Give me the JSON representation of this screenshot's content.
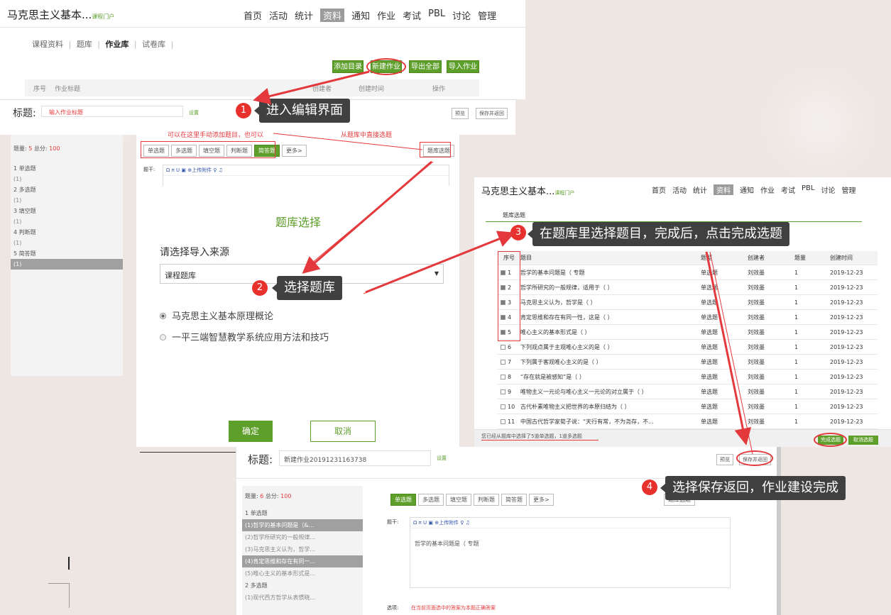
{
  "main_header": {
    "title": "马克思主义基本...",
    "portal": "课程门户",
    "nav": [
      "首页",
      "活动",
      "统计",
      "资料",
      "通知",
      "作业",
      "考试",
      "PBL",
      "讨论",
      "管理"
    ],
    "active_nav": "资料"
  },
  "subtabs": [
    "课程资料",
    "题库",
    "作业库",
    "试卷库"
  ],
  "active_subtab": "作业库",
  "toolbar": {
    "add_dir": "添加目录",
    "new_work": "新建作业",
    "export_all": "导出全部",
    "import_work": "导入作业"
  },
  "list_headers": {
    "no": "序号",
    "title": "作业标题",
    "creator": "创建者",
    "time": "创建时间",
    "op": "操作"
  },
  "editor1": {
    "title_label": "标题:",
    "title_placeholder": "输入作业标题",
    "setting": "设置",
    "preview": "预览",
    "save_return": "保存并返回",
    "count_label": "题量:",
    "count": "5",
    "score_label": "总分:",
    "score": "100",
    "stem_label": "题干:"
  },
  "outline1": [
    "1 单选题",
    "(1)",
    "2 多选题",
    "(1)",
    "3 填空题",
    "(1)",
    "4 判断题",
    "(1)",
    "5 简答题",
    "(1)"
  ],
  "type_buttons": [
    "单选题",
    "多选题",
    "填空题",
    "判断题",
    "简答题",
    "更多>"
  ],
  "bank_select_btn": "题库选题",
  "notes": {
    "manual": "可以在这里手动添加题目，也可以",
    "from_bank": "从题库中直接选题"
  },
  "editor_tools": "Ω π U ▣ ⊕上传附件 ♀ ♫",
  "dialog": {
    "title": "题库选择",
    "prompt": "请选择导入来源",
    "select": "课程题库",
    "options": [
      "马克思主义基本原理概论",
      "一平三端智慧教学系统应用方法和技巧"
    ],
    "ok": "确定",
    "cancel": "取消"
  },
  "callouts": [
    {
      "n": "1",
      "text": "进入编辑界面"
    },
    {
      "n": "2",
      "text": "选择题库"
    },
    {
      "n": "3",
      "text": "在题库里选择题目，完成后，点击完成选题"
    },
    {
      "n": "4",
      "text": "选择保存返回，作业建设完成"
    }
  ],
  "bank": {
    "tab": "题库选题",
    "headers": {
      "no": "序号",
      "q": "题目",
      "type": "题型",
      "creator": "创建者",
      "count": "题量",
      "time": "创建时间"
    },
    "rows": [
      {
        "n": "1",
        "q": "哲学的基本问题是（ 专题",
        "type": "单选题",
        "c": "刘效墨",
        "k": "1",
        "t": "2019-12-23",
        "checked": true
      },
      {
        "n": "2",
        "q": "哲学所研究的一般规律，适用于（ ）",
        "type": "单选题",
        "c": "刘效墨",
        "k": "1",
        "t": "2019-12-23",
        "checked": true
      },
      {
        "n": "3",
        "q": "马克思主义认为，哲学是（ ）",
        "type": "单选题",
        "c": "刘效墨",
        "k": "1",
        "t": "2019-12-23",
        "checked": true
      },
      {
        "n": "4",
        "q": "肯定思维和存在有同一性，这是（ ）",
        "type": "单选题",
        "c": "刘效墨",
        "k": "1",
        "t": "2019-12-23",
        "checked": true
      },
      {
        "n": "5",
        "q": "唯心主义的基本形式是（ ）",
        "type": "单选题",
        "c": "刘效墨",
        "k": "1",
        "t": "2019-12-23",
        "checked": true
      },
      {
        "n": "6",
        "q": "下列观点属于主观唯心主义的是（ ）",
        "type": "单选题",
        "c": "刘效墨",
        "k": "1",
        "t": "2019-12-23",
        "checked": false
      },
      {
        "n": "7",
        "q": "下列属于客观唯心主义的是（ ）",
        "type": "单选题",
        "c": "刘效墨",
        "k": "1",
        "t": "2019-12-23",
        "checked": false
      },
      {
        "n": "8",
        "q": "“存在就是被感知”是（ ）",
        "type": "单选题",
        "c": "刘效墨",
        "k": "1",
        "t": "2019-12-23",
        "checked": false
      },
      {
        "n": "9",
        "q": "唯物主义一元论与唯心主义一元论的对立属于（ ）",
        "type": "单选题",
        "c": "刘效墨",
        "k": "1",
        "t": "2019-12-23",
        "checked": false
      },
      {
        "n": "10",
        "q": "古代朴素唯物主义把世界的本原归结为（ ）",
        "type": "单选题",
        "c": "刘效墨",
        "k": "1",
        "t": "2019-12-23",
        "checked": false
      },
      {
        "n": "11",
        "q": "中国古代哲学家荀子说：“天行有常，不为尧存，不...",
        "type": "单选题",
        "c": "刘效墨",
        "k": "1",
        "t": "2019-12-23",
        "checked": false
      }
    ],
    "status": "您已经从题库中选择了5道单选题，1道多选题",
    "finish": "完成选题",
    "cancel": "取消选题"
  },
  "editor2": {
    "title_label": "标题:",
    "title_value": "新建作业20191231163738",
    "setting": "设置",
    "preview": "预览",
    "save_return": "保存并返回",
    "count_label": "题量:",
    "count": "6",
    "score_label": "总分:",
    "score": "100",
    "stem_label": "题干:",
    "stem_text": "哲学的基本问题是（ 专题",
    "options_label": "选项:",
    "options_hint": "在当前页面选中的答案为本题正确答案"
  },
  "outline2": [
    "1 单选题",
    "(1)哲学的基本问题是（&...",
    "(2)哲学所研究的一般规律...",
    "(3)马克思主义认为，哲学...",
    "(4)肯定思维和存在有同一...",
    "(5)唯心主义的基本形式是...",
    "2 多选题",
    "(1)现代西方哲学从表惯晓..."
  ]
}
